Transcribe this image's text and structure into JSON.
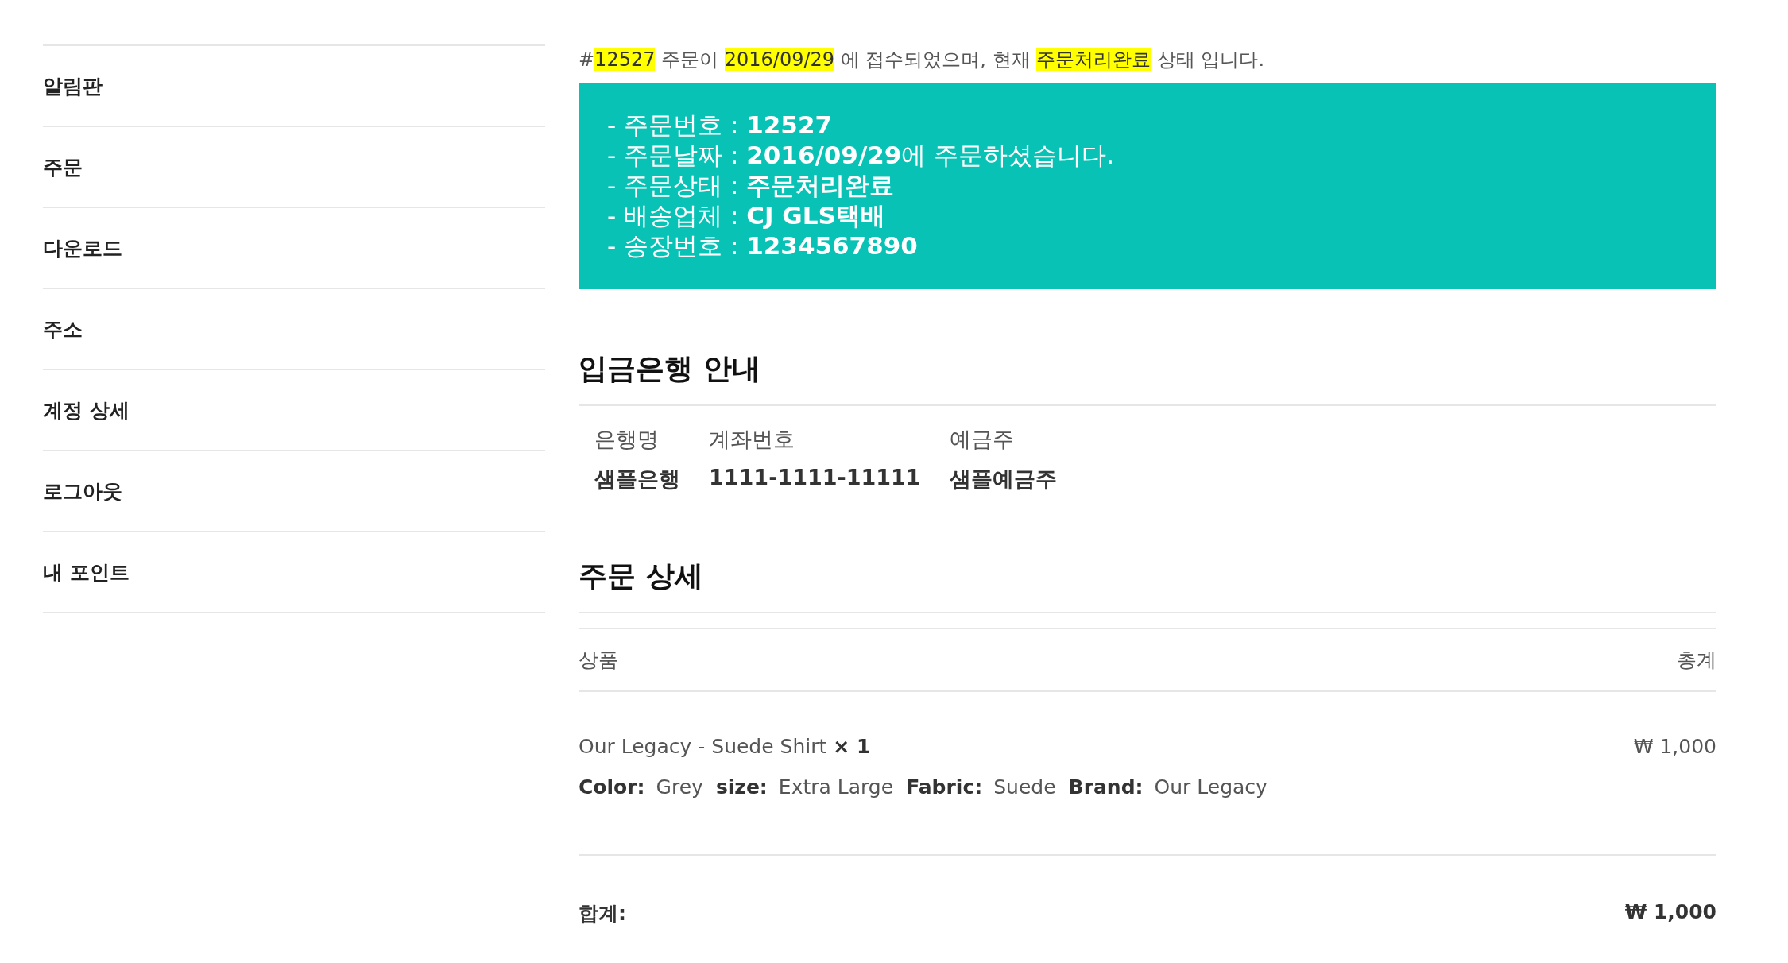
{
  "sidebar": {
    "items": [
      {
        "label": "알림판"
      },
      {
        "label": "주문"
      },
      {
        "label": "다운로드"
      },
      {
        "label": "주소"
      },
      {
        "label": "계정 상세"
      },
      {
        "label": "로그아웃"
      },
      {
        "label": "내 포인트"
      }
    ]
  },
  "notice": {
    "segments": [
      {
        "text": "#",
        "highlighted": false
      },
      {
        "text": "12527",
        "highlighted": true
      },
      {
        "text": " 주문이 ",
        "highlighted": false
      },
      {
        "text": "2016/09/29",
        "highlighted": true
      },
      {
        "text": " 에 접수되었으며, 현재 ",
        "highlighted": false
      },
      {
        "text": "주문처리완료",
        "highlighted": true
      },
      {
        "text": " 상태 입니다.",
        "highlighted": false
      }
    ]
  },
  "status_box": {
    "lines": [
      "- 주문번호 : **12527**",
      "- 주문날짜 : **2016/09/29**에 주문하셨습니다.",
      "- 주문상태 : **주문처리완료**",
      "- 배송업체 : **CJ GLS택배**",
      "- 송장번호 : **1234567890**"
    ]
  },
  "bank": {
    "heading": "입금은행 안내",
    "columns": [
      "은행명",
      "계좌번호",
      "예금주"
    ],
    "row": [
      "샘플은행",
      "1111-1111-11111",
      "샘플예금주"
    ]
  },
  "order_details": {
    "heading": "주문 상세",
    "columns": [
      "상품",
      "총계"
    ],
    "items": [
      {
        "name": "Our Legacy - Suede Shirt",
        "quantity": "× 1",
        "price": "₩ 1,000",
        "meta": [
          {
            "key": "Color:",
            "value": "Grey"
          },
          {
            "key": "size:",
            "value": "Extra Large"
          },
          {
            "key": "Fabric:",
            "value": "Suede"
          },
          {
            "key": "Brand:",
            "value": "Our Legacy"
          }
        ]
      }
    ],
    "total": {
      "label": "합계:",
      "value": "₩ 1,000"
    }
  }
}
